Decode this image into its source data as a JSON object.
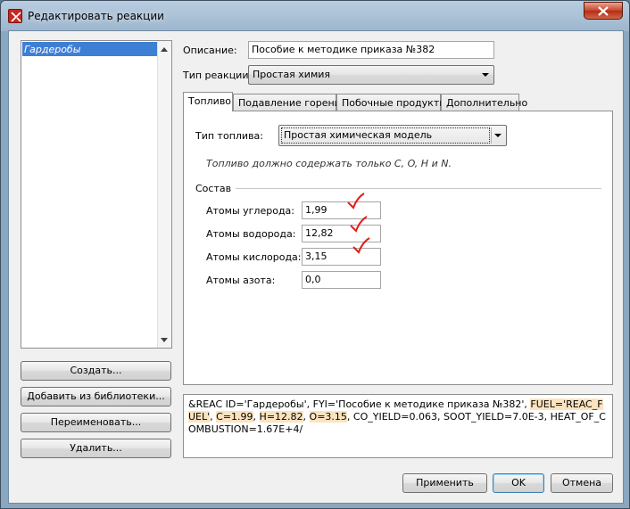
{
  "window": {
    "title": "Редактировать реакции"
  },
  "reaction_list": {
    "items": [
      "Гардеробы"
    ],
    "selected": 0
  },
  "left_buttons": {
    "create": "Создать...",
    "add_from_library": "Добавить из библиотеки...",
    "rename": "Переименовать...",
    "delete": "Удалить..."
  },
  "form": {
    "description_label": "Описание:",
    "description_value": "Пособие к методике приказа №382",
    "reaction_type_label": "Тип реакции:",
    "reaction_type_value": "Простая химия"
  },
  "tabs": [
    {
      "label": "Топливо",
      "active": true
    },
    {
      "label": "Подавление горения",
      "active": false
    },
    {
      "label": "Побочные продукты",
      "active": false
    },
    {
      "label": "Дополнительно",
      "active": false
    }
  ],
  "fuel": {
    "fuel_type_label": "Тип топлива:",
    "fuel_type_value": "Простая химическая модель",
    "hint": "Топливо должно содержать только C, O, H и N.",
    "composition_label": "Состав",
    "carbon_label": "Атомы углерода:",
    "carbon_value": "1,99",
    "hydrogen_label": "Атомы водорода:",
    "hydrogen_value": "12,82",
    "oxygen_label": "Атомы кислорода:",
    "oxygen_value": "3,15",
    "nitrogen_label": "Атомы азота:",
    "nitrogen_value": "0,0"
  },
  "output": {
    "part1": "&REAC ID='Гардеробы', FYI='Пособие к методике приказа №382', ",
    "fuel": "FUEL='REAC_FUEL'",
    "sep1": ", ",
    "c": "C=1.99",
    "sep2": ", ",
    "h": "H=12.82",
    "sep3": ", ",
    "o": "O=3.15",
    "part2": ", CO_YIELD=0.063, SOOT_YIELD=7.0E-3, HEAT_OF_COMBUSTION=1.67E+4/"
  },
  "bottom_buttons": {
    "apply": "Применить",
    "ok": "OK",
    "cancel": "Отмена"
  },
  "colors": {
    "selection": "#3e7fd6",
    "highlight": "#fce3bf",
    "checkmark": "#e0201a",
    "close": "#c7432a"
  }
}
